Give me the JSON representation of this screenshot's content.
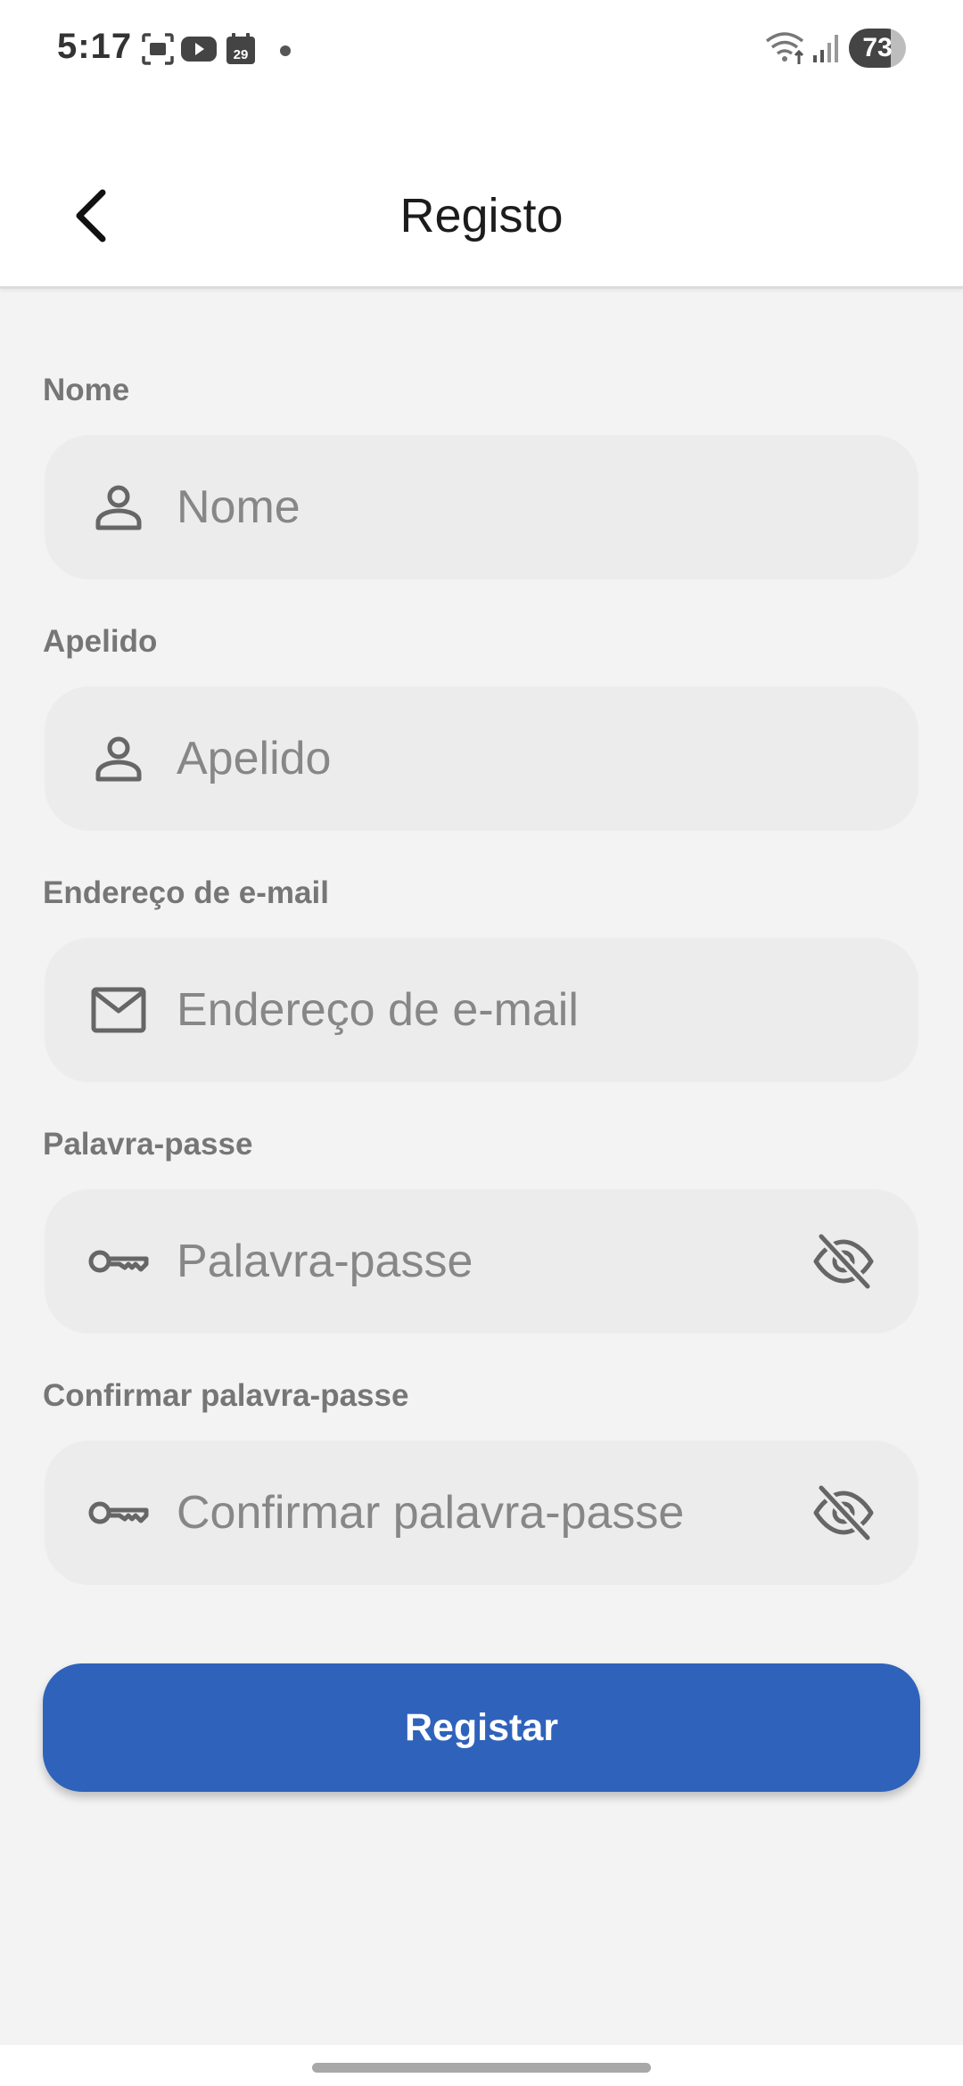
{
  "status_bar": {
    "time": "5:17",
    "calendar_day": "29",
    "battery_level": "73",
    "battery_fraction": 0.73
  },
  "header": {
    "title": "Registo",
    "back_icon": "chevron-left-icon"
  },
  "form": {
    "fields": [
      {
        "label": "Nome",
        "placeholder": "Nome",
        "value": "",
        "icon": "person-icon"
      },
      {
        "label": "Apelido",
        "placeholder": "Apelido",
        "value": "",
        "icon": "person-icon"
      },
      {
        "label": "Endereço de e-mail",
        "placeholder": "Endereço de e-mail",
        "value": "",
        "icon": "mail-icon"
      },
      {
        "label": "Palavra-passe",
        "placeholder": "Palavra-passe",
        "value": "",
        "icon": "key-icon",
        "toggle_icon": "visibility-off-icon"
      },
      {
        "label": "Confirmar palavra-passe",
        "placeholder": "Confirmar palavra-passe",
        "value": "",
        "icon": "key-icon",
        "toggle_icon": "visibility-off-icon"
      }
    ],
    "submit_label": "Registar"
  },
  "colors": {
    "primary": "#2f62bb",
    "background": "#f3f3f3",
    "field_background": "#ececec",
    "label": "#767676",
    "placeholder": "#878787"
  }
}
